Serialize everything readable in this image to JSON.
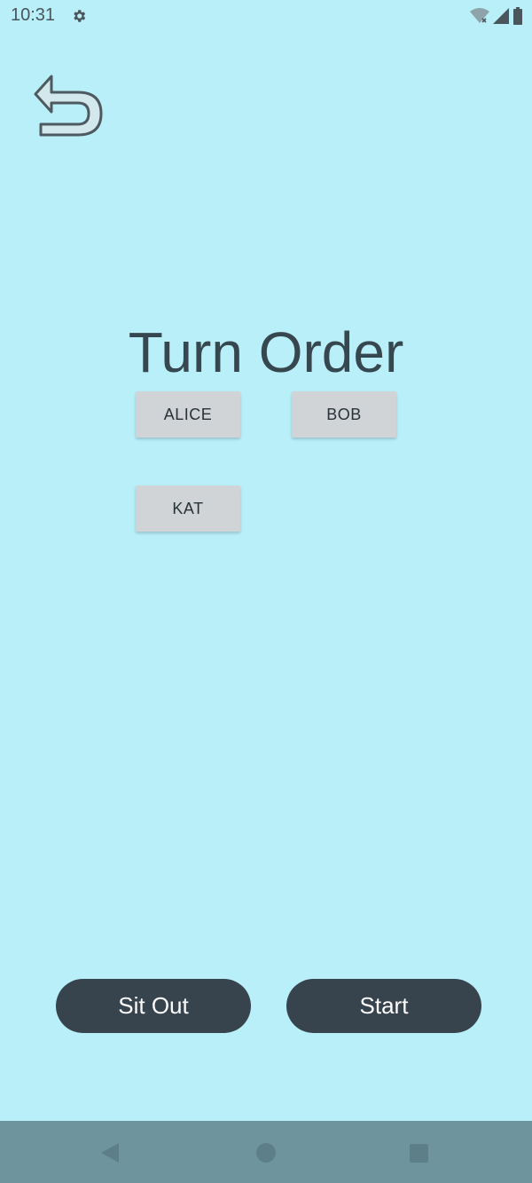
{
  "status_bar": {
    "time": "10:31",
    "icons": [
      "settings-icon",
      "wifi-icon",
      "signal-icon",
      "battery-icon"
    ]
  },
  "toolbar": {
    "back_icon": "undo-arrow-icon"
  },
  "main": {
    "title": "Turn Order",
    "players": [
      {
        "label": "ALICE"
      },
      {
        "label": "BOB"
      },
      {
        "label": "KAT"
      }
    ]
  },
  "actions": {
    "sit_out_label": "Sit Out",
    "start_label": "Start"
  },
  "navigation": {
    "icons": [
      "nav-back-icon",
      "nav-home-icon",
      "nav-recents-icon"
    ]
  },
  "colors": {
    "background": "#b9eff9",
    "title_text": "#37474f",
    "player_button": "#d0d4d6",
    "action_button": "#37434d",
    "nav_bar": "#6e959e"
  }
}
